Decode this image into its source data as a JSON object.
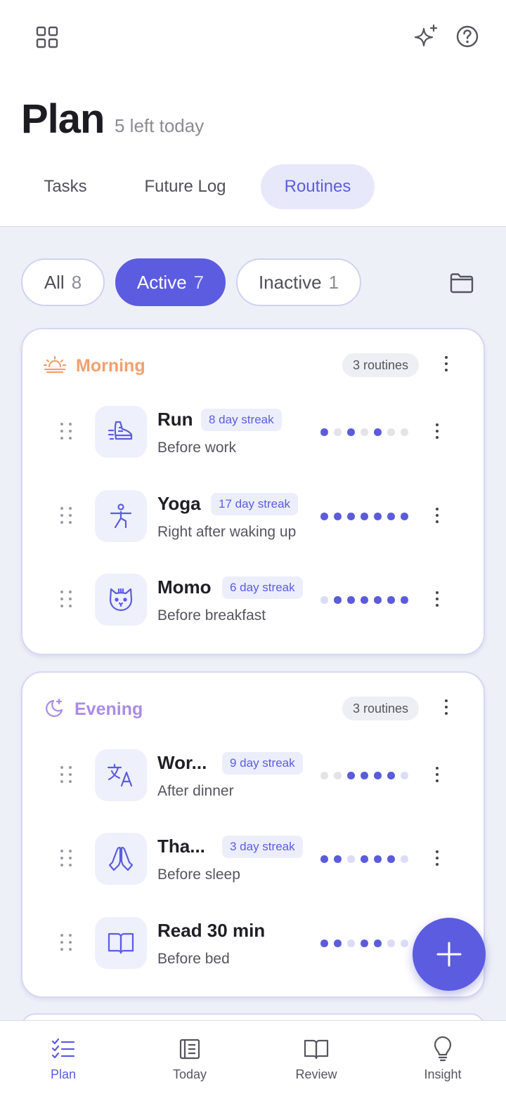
{
  "header": {
    "title": "Plan",
    "subtitle": "5 left today"
  },
  "tabs": [
    {
      "label": "Tasks",
      "active": false
    },
    {
      "label": "Future Log",
      "active": false
    },
    {
      "label": "Routines",
      "active": true
    }
  ],
  "filters": [
    {
      "label": "All",
      "count": "8",
      "active": false
    },
    {
      "label": "Active",
      "count": "7",
      "active": true
    },
    {
      "label": "Inactive",
      "count": "1",
      "active": false
    }
  ],
  "groups": [
    {
      "title": "Morning",
      "count_label": "3 routines",
      "color": "#f0a070",
      "icon": "sunrise-icon",
      "routines": [
        {
          "name": "Run",
          "streak": "8 day streak",
          "subtitle": "Before work",
          "icon": "running-shoe-icon",
          "week": [
            2,
            0,
            2,
            0,
            2,
            0,
            0
          ]
        },
        {
          "name": "Yoga",
          "streak": "17 day streak",
          "subtitle": "Right after waking up",
          "icon": "yoga-pose-icon",
          "week": [
            2,
            2,
            2,
            2,
            2,
            2,
            2
          ]
        },
        {
          "name": "Momo",
          "streak": "6 day streak",
          "subtitle": "Before breakfast",
          "icon": "cat-face-icon",
          "week": [
            1,
            2,
            2,
            2,
            2,
            2,
            2
          ]
        }
      ]
    },
    {
      "title": "Evening",
      "count_label": "3 routines",
      "color": "#a98ce6",
      "icon": "moon-stars-icon",
      "routines": [
        {
          "name": "Wor...",
          "streak": "9 day streak",
          "subtitle": "After dinner",
          "icon": "translate-icon",
          "week": [
            0,
            0,
            2,
            2,
            2,
            2,
            1
          ]
        },
        {
          "name": "Tha...",
          "streak": "3 day streak",
          "subtitle": "Before sleep",
          "icon": "praying-hands-icon",
          "week": [
            2,
            2,
            1,
            2,
            2,
            2,
            1
          ]
        },
        {
          "name": "Read 30 min",
          "streak": "",
          "subtitle": "Before bed",
          "icon": "open-book-icon",
          "week": [
            2,
            2,
            1,
            2,
            2,
            1,
            1
          ]
        }
      ]
    }
  ],
  "bottom_nav": [
    {
      "label": "Plan",
      "icon": "checklist-icon",
      "active": true
    },
    {
      "label": "Today",
      "icon": "journal-page-icon",
      "active": false
    },
    {
      "label": "Review",
      "icon": "open-book-icon",
      "active": false
    },
    {
      "label": "Insight",
      "icon": "lightbulb-icon",
      "active": false
    }
  ],
  "colors": {
    "accent": "#5c5ce0",
    "background": "#eef0f8",
    "morning": "#f0a070",
    "evening": "#a98ce6"
  }
}
